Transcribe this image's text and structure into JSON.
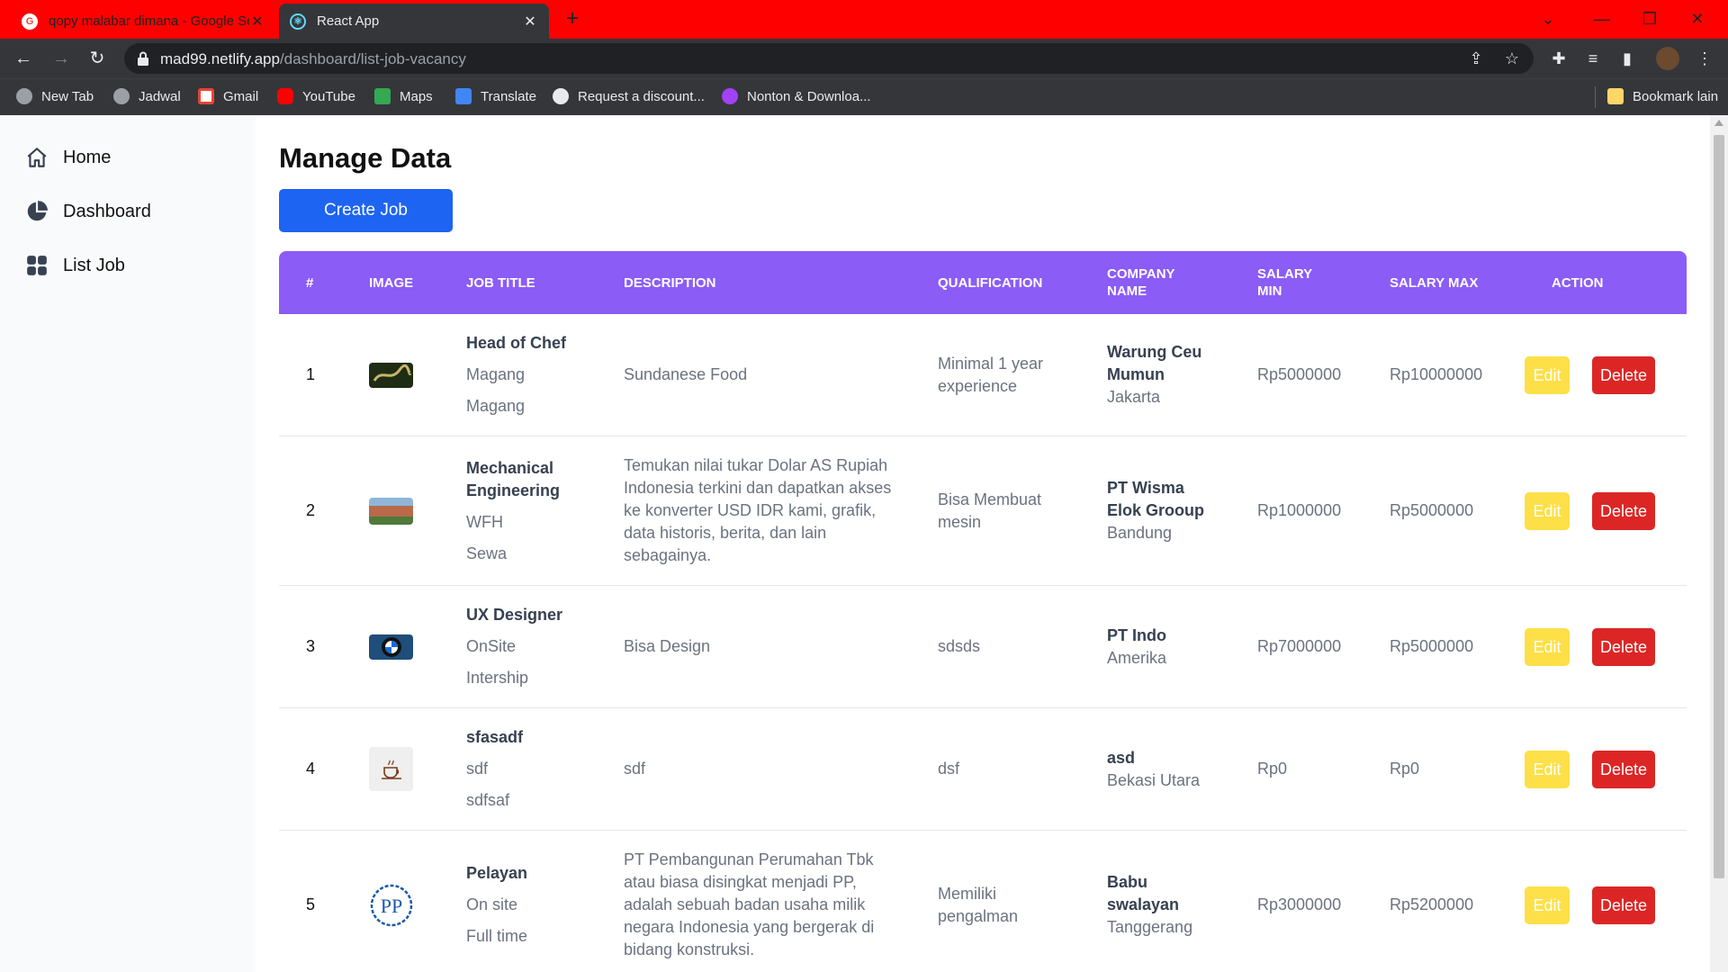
{
  "browser": {
    "tabs": [
      {
        "title": "qopy malabar dimana - Google Search",
        "favicon": "google-icon",
        "active": false
      },
      {
        "title": "React App",
        "favicon": "react-icon",
        "active": true
      }
    ],
    "url_host": "mad99.netlify.app",
    "url_path": "/dashboard/list-job-vacancy",
    "bookmarks": [
      {
        "label": "New Tab",
        "icon": "globe-icon"
      },
      {
        "label": "Jadwal",
        "icon": "globe-icon"
      },
      {
        "label": "Gmail",
        "icon": "gmail-icon"
      },
      {
        "label": "YouTube",
        "icon": "youtube-icon"
      },
      {
        "label": "Maps",
        "icon": "maps-icon"
      },
      {
        "label": "Translate",
        "icon": "translate-icon"
      },
      {
        "label": "Request a discount...",
        "icon": "github-icon"
      },
      {
        "label": "Nonton & Downloa...",
        "icon": "film-icon"
      }
    ],
    "other_bookmarks": "Bookmark lain"
  },
  "sidebar": {
    "items": [
      {
        "label": "Home",
        "icon": "home-icon"
      },
      {
        "label": "Dashboard",
        "icon": "pie-chart-icon"
      },
      {
        "label": "List Job",
        "icon": "grid-icon"
      }
    ]
  },
  "main": {
    "title": "Manage Data",
    "create_label": "Create Job"
  },
  "table": {
    "headers": {
      "num": "#",
      "image": "IMAGE",
      "job_title": "JOB TITLE",
      "description": "DESCRIPTION",
      "qualification": "QUALIFICATION",
      "company_1": "COMPANY",
      "company_2": "NAME",
      "salary_min_1": "SALARY",
      "salary_min_2": "MIN",
      "salary_max": "SALARY MAX",
      "action": "ACTION"
    },
    "edit_label": "Edit",
    "delete_label": "Delete",
    "rows": [
      {
        "num": "1",
        "image": "restaurant-logo",
        "title": "Head of Chef",
        "type": "Magang",
        "tenure": "Magang",
        "description": "Sundanese Food",
        "qualification": "Minimal 1 year experience",
        "company": "Warung Ceu Mumun",
        "city": "Jakarta",
        "salary_min": "Rp5000000",
        "salary_max": "Rp10000000"
      },
      {
        "num": "2",
        "image": "building-photo",
        "title": "Mechanical Engineering",
        "type": "WFH",
        "tenure": "Sewa",
        "description": "Temukan nilai tukar Dolar AS Rupiah Indonesia terkini dan dapatkan akses ke konverter USD IDR kami, grafik, data historis, berita, dan lain sebagainya.",
        "qualification": "Bisa Membuat mesin",
        "company": "PT Wisma Elok Grooup",
        "city": "Bandung",
        "salary_min": "Rp1000000",
        "salary_max": "Rp5000000"
      },
      {
        "num": "3",
        "image": "bmw-logo",
        "title": "UX Designer",
        "type": "OnSite",
        "tenure": "Intership",
        "description": "Bisa Design",
        "qualification": "sdsds",
        "company": "PT Indo",
        "city": "Amerika",
        "salary_min": "Rp7000000",
        "salary_max": "Rp5000000"
      },
      {
        "num": "4",
        "image": "coffee-cup-logo",
        "title": "sfasadf",
        "type": "sdf",
        "tenure": "sdfsaf",
        "description": "sdf",
        "qualification": "dsf",
        "company": "asd",
        "city": "Bekasi Utara",
        "salary_min": "Rp0",
        "salary_max": "Rp0"
      },
      {
        "num": "5",
        "image": "pp-logo",
        "title": "Pelayan",
        "type": "On site",
        "tenure": "Full time",
        "description": "PT Pembangunan Perumahan Tbk atau biasa disingkat menjadi PP, adalah sebuah badan usaha milik negara Indonesia yang bergerak di bidang konstruksi.",
        "qualification": "Memiliki pengalman",
        "company": "Babu swalayan",
        "city": "Tanggerang",
        "salary_min": "Rp3000000",
        "salary_max": "Rp5200000"
      }
    ]
  },
  "colors": {
    "header_purple": "#8b5cf6",
    "create_blue": "#1d64f2",
    "edit_yellow": "#fde047",
    "delete_red": "#dc2626",
    "tabbar_red": "#ff0000"
  }
}
